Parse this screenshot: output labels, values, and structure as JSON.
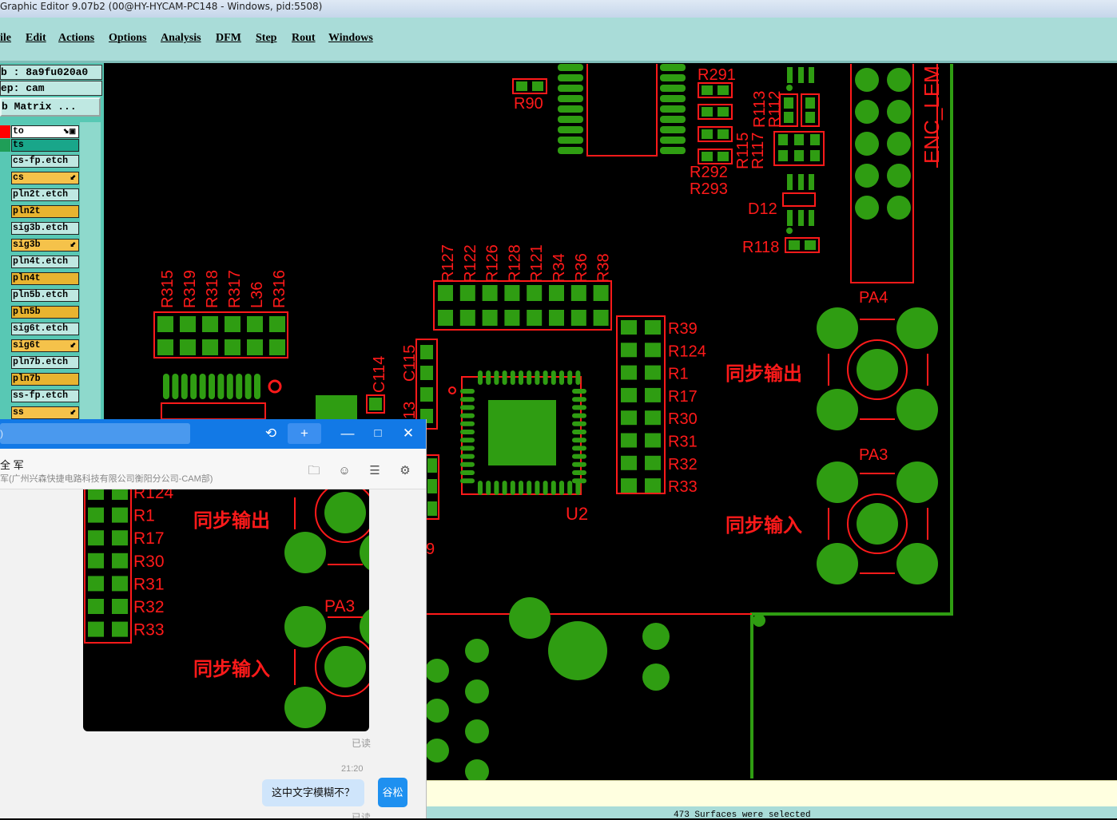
{
  "window": {
    "title": "Graphic Editor 9.07b2 (00@HY-HYCAM-PC148 - Windows, pid:5508)"
  },
  "menu": [
    "ile",
    "Edit",
    "Actions",
    "Options",
    "Analysis",
    "DFM",
    "Step",
    "Rout",
    "Windows"
  ],
  "left_panel": {
    "job_line": "b : 8a9fu020a0",
    "step_line": "ep: cam",
    "matrix_button": "b Matrix ...",
    "layers": [
      {
        "name": "to",
        "color": "#ffffff",
        "swatch": "#ff0000",
        "icon": "⬊▣"
      },
      {
        "name": "ts",
        "color": "#19a68a",
        "swatch": "#1f9e57",
        "icon": ""
      },
      {
        "name": "cs-fp.etch",
        "color": "#bfe8e2",
        "swatch": "#58c8b4",
        "icon": ""
      },
      {
        "name": "cs",
        "color": "#f5c24a",
        "swatch": "#58c8b4",
        "icon": "⬋"
      },
      {
        "name": "pln2t.etch",
        "color": "#bfe8e2",
        "swatch": "#58c8b4",
        "icon": ""
      },
      {
        "name": "pln2t",
        "color": "#e8b430",
        "swatch": "#58c8b4",
        "icon": ""
      },
      {
        "name": "sig3b.etch",
        "color": "#bfe8e2",
        "swatch": "#58c8b4",
        "icon": ""
      },
      {
        "name": "sig3b",
        "color": "#f5c24a",
        "swatch": "#58c8b4",
        "icon": "⬋"
      },
      {
        "name": "pln4t.etch",
        "color": "#bfe8e2",
        "swatch": "#58c8b4",
        "icon": ""
      },
      {
        "name": "pln4t",
        "color": "#e8b430",
        "swatch": "#58c8b4",
        "icon": ""
      },
      {
        "name": "pln5b.etch",
        "color": "#bfe8e2",
        "swatch": "#58c8b4",
        "icon": ""
      },
      {
        "name": "pln5b",
        "color": "#e8b430",
        "swatch": "#58c8b4",
        "icon": ""
      },
      {
        "name": "sig6t.etch",
        "color": "#bfe8e2",
        "swatch": "#58c8b4",
        "icon": ""
      },
      {
        "name": "sig6t",
        "color": "#f5c24a",
        "swatch": "#58c8b4",
        "icon": "⬋"
      },
      {
        "name": "pln7b.etch",
        "color": "#bfe8e2",
        "swatch": "#58c8b4",
        "icon": ""
      },
      {
        "name": "pln7b",
        "color": "#e8b430",
        "swatch": "#58c8b4",
        "icon": ""
      },
      {
        "name": "ss-fp.etch",
        "color": "#bfe8e2",
        "swatch": "#58c8b4",
        "icon": ""
      },
      {
        "name": "ss",
        "color": "#f5c24a",
        "swatch": "#58c8b4",
        "icon": "⬋"
      }
    ]
  },
  "pcb_labels": {
    "r291": "R291",
    "r90": "R90",
    "r113": "R113",
    "r112": "R112",
    "r115": "R115",
    "r117": "R117",
    "r292": "R292",
    "r293": "R293",
    "d12": "D12",
    "r118": "R118",
    "enc": "ENC_LEM",
    "pa4": "PA4",
    "pa3": "PA3",
    "sync_out": "同步输出",
    "sync_in": "同步输入",
    "u2": "U2",
    "c114": "C114",
    "c115": "C115",
    "c13": "13",
    "top_row": [
      "R315",
      "R319",
      "R318",
      "R317",
      "L36",
      "R316"
    ],
    "mid_row": [
      "R127",
      "R122",
      "R126",
      "R128",
      "R121",
      "R34",
      "R36",
      "R38"
    ],
    "right_col": [
      "R39",
      "R124",
      "R1",
      "R17",
      "R30",
      "R31",
      "R32",
      "R33"
    ]
  },
  "status": {
    "selection": "473 Surfaces were selected"
  },
  "chat": {
    "search_placeholder": ")",
    "contact_name": "全 军",
    "contact_org": "军(广州兴森快捷电路科技有限公司衡阳分公司-CAM部)",
    "image_labels": {
      "rows": [
        "R124",
        "R1",
        "R17",
        "R30",
        "R31",
        "R32",
        "R33"
      ],
      "sync_out": "同步输出",
      "sync_in": "同步输入",
      "pa3": "PA3"
    },
    "read_1": "已读",
    "time": "21:20",
    "message": "这中文字模糊不？",
    "avatar": "谷松",
    "read_2": "已读"
  },
  "colors": {
    "pad": "#2f9d12",
    "outline": "#ff1a1a",
    "menu_bg": "#a9dcd8",
    "panel_bg": "#58c8b4",
    "chat_blue": "#1279e6"
  }
}
